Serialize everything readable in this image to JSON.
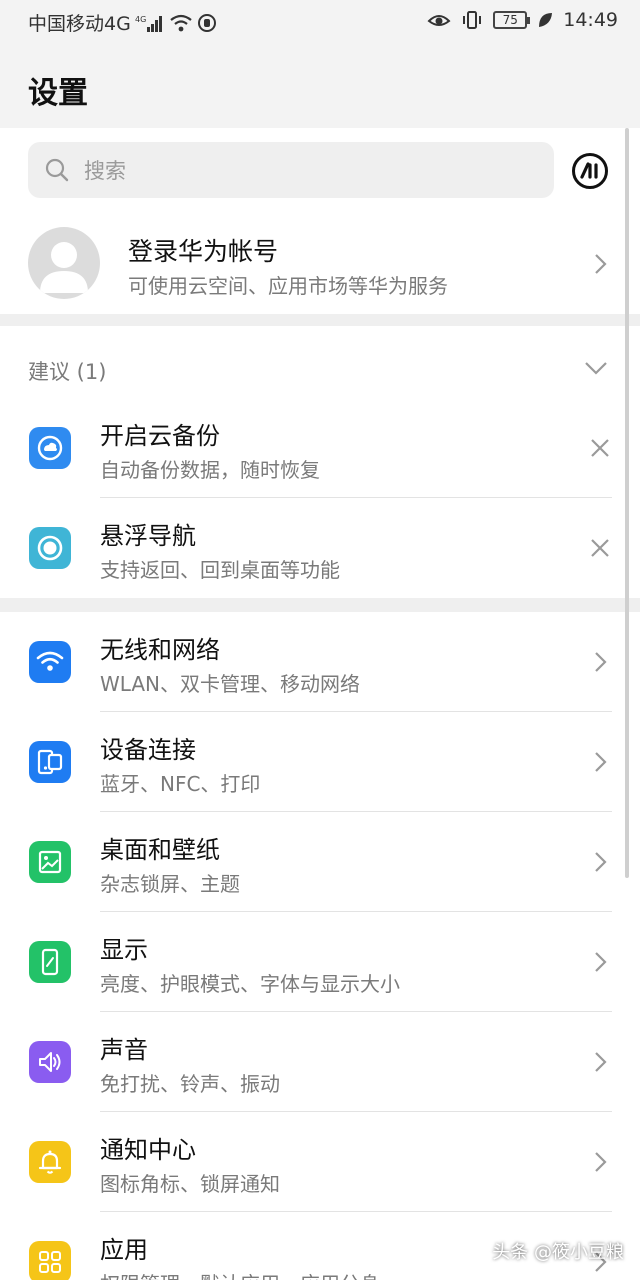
{
  "status_bar": {
    "carrier": "中国移动4G",
    "battery": "75",
    "time": "14:49"
  },
  "header": {
    "title": "设置"
  },
  "search": {
    "placeholder": "搜索"
  },
  "account": {
    "title": "登录华为帐号",
    "subtitle": "可使用云空间、应用市场等华为服务"
  },
  "suggestions": {
    "label": "建议 (1)",
    "items": [
      {
        "title": "开启云备份",
        "subtitle": "自动备份数据，随时恢复",
        "icon": "cloud-backup-icon"
      },
      {
        "title": "悬浮导航",
        "subtitle": "支持返回、回到桌面等功能",
        "icon": "floating-nav-icon"
      }
    ]
  },
  "settings": {
    "items": [
      {
        "title": "无线和网络",
        "subtitle": "WLAN、双卡管理、移动网络",
        "icon": "wifi-icon",
        "color": "#1f7cf2"
      },
      {
        "title": "设备连接",
        "subtitle": "蓝牙、NFC、打印",
        "icon": "device-connect-icon",
        "color": "#1f7cf2"
      },
      {
        "title": "桌面和壁纸",
        "subtitle": "杂志锁屏、主题",
        "icon": "wallpaper-icon",
        "color": "#23c268"
      },
      {
        "title": "显示",
        "subtitle": "亮度、护眼模式、字体与显示大小",
        "icon": "display-icon",
        "color": "#23c268"
      },
      {
        "title": "声音",
        "subtitle": "免打扰、铃声、振动",
        "icon": "sound-icon",
        "color": "#8a5cf0"
      },
      {
        "title": "通知中心",
        "subtitle": "图标角标、锁屏通知",
        "icon": "bell-icon",
        "color": "#f5c518"
      },
      {
        "title": "应用",
        "subtitle": "权限管理、默认应用、应用分身",
        "icon": "apps-icon",
        "color": "#f5c518"
      }
    ]
  },
  "watermark": "头条 @筱小豆粮"
}
